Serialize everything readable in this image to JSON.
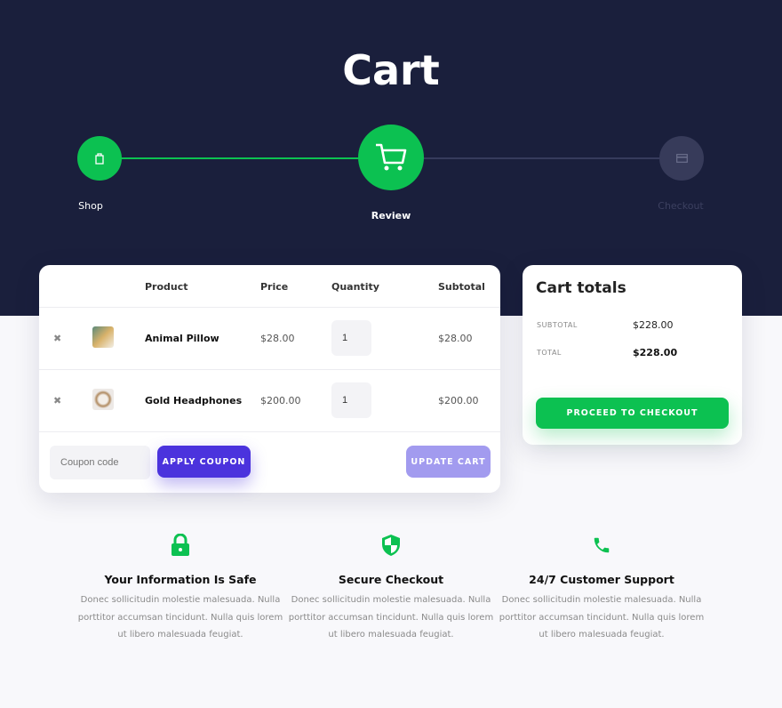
{
  "title": "Cart",
  "steps": [
    {
      "label": "Shop",
      "icon": "shopping-bag-icon",
      "state": "done"
    },
    {
      "label": "Review",
      "icon": "cart-icon",
      "state": "active"
    },
    {
      "label": "Checkout",
      "icon": "credit-card-icon",
      "state": "pending"
    }
  ],
  "table": {
    "headers": [
      "Product",
      "Price",
      "Quantity",
      "Subtotal"
    ],
    "rows": [
      {
        "name": "Animal Pillow",
        "price": "$28.00",
        "quantity": "1",
        "subtotal": "$28.00"
      },
      {
        "name": "Gold Headphones",
        "price": "$200.00",
        "quantity": "1",
        "subtotal": "$200.00"
      }
    ],
    "remove": "✖",
    "coupon_placeholder": "Coupon code",
    "apply_label": "APPLY COUPON",
    "update_label": "UPDATE CART"
  },
  "totals": {
    "title": "Cart totals",
    "subtotal_label": "SUBTOTAL",
    "subtotal": "$228.00",
    "total_label": "TOTAL",
    "total": "$228.00",
    "checkout_label": "PROCEED TO CHECKOUT"
  },
  "features": [
    {
      "icon": "lock-icon",
      "title": "Your Information Is Safe",
      "text": "Donec sollicitudin molestie malesuada. Nulla porttitor accumsan tincidunt. Nulla quis lorem ut libero malesuada feugiat."
    },
    {
      "icon": "shield-icon",
      "title": "Secure Checkout",
      "text": "Donec sollicitudin molestie malesuada. Nulla porttitor accumsan tincidunt. Nulla quis lorem ut libero malesuada feugiat."
    },
    {
      "icon": "phone-icon",
      "title": "24/7 Customer Support",
      "text": "Donec sollicitudin molestie malesuada. Nulla porttitor accumsan tincidunt. Nulla quis lorem ut libero malesuada feugiat."
    }
  ],
  "colors": {
    "accent": "#0cc151",
    "primary": "#4b33dd",
    "hero": "#1a1f3c"
  }
}
